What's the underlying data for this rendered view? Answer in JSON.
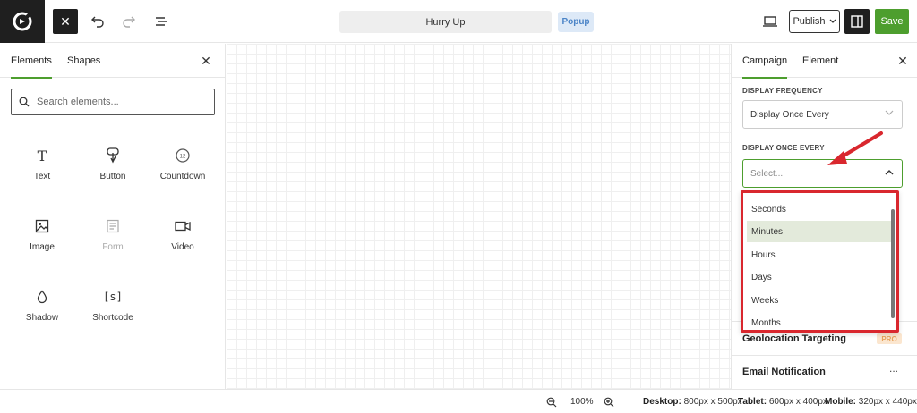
{
  "header": {
    "campaign_title": "Hurry Up",
    "campaign_type": "Popup",
    "publish_label": "Publish",
    "save_label": "Save"
  },
  "left_panel": {
    "tabs": [
      {
        "label": "Elements",
        "active": true
      },
      {
        "label": "Shapes",
        "active": false
      }
    ],
    "search_placeholder": "Search elements...",
    "elements": [
      {
        "label": "Text",
        "icon": "text-icon",
        "enabled": true
      },
      {
        "label": "Button",
        "icon": "button-icon",
        "enabled": true
      },
      {
        "label": "Countdown",
        "icon": "countdown-icon",
        "enabled": true
      },
      {
        "label": "Image",
        "icon": "image-icon",
        "enabled": true
      },
      {
        "label": "Form",
        "icon": "form-icon",
        "enabled": false
      },
      {
        "label": "Video",
        "icon": "video-icon",
        "enabled": true
      },
      {
        "label": "Shadow",
        "icon": "shadow-icon",
        "enabled": true
      },
      {
        "label": "Shortcode",
        "icon": "shortcode-icon",
        "enabled": true
      }
    ],
    "shortcode_glyph": "[s]",
    "text_glyph": "T",
    "countdown_glyph": "12"
  },
  "right_panel": {
    "tabs": [
      {
        "label": "Campaign",
        "active": true
      },
      {
        "label": "Element",
        "active": false
      }
    ],
    "display_frequency_label": "DISPLAY FREQUENCY",
    "display_frequency_value": "Display Once Every",
    "display_once_every_label": "DISPLAY ONCE EVERY",
    "display_once_every_placeholder": "Select...",
    "options": [
      "Seconds",
      "Minutes",
      "Hours",
      "Days",
      "Weeks",
      "Months"
    ],
    "hovered_option": "Minutes",
    "geolocation_label": "Geolocation Targeting",
    "pro_badge": "PRO",
    "email_notification_label": "Email Notification",
    "more_glyph": "..."
  },
  "footer": {
    "zoom": "100%",
    "desktop_label": "Desktop:",
    "desktop_size": "800px x 500px",
    "tablet_label": "Tablet:",
    "tablet_size": "600px x 400px",
    "mobile_label": "Mobile:",
    "mobile_size": "320px x 440px"
  },
  "colors": {
    "accent": "#4d9e2e",
    "dark": "#1f1f1f",
    "annotation": "#d9272e",
    "popup_badge_bg": "#dde9f7",
    "hover_bg": "#e3eadb"
  }
}
